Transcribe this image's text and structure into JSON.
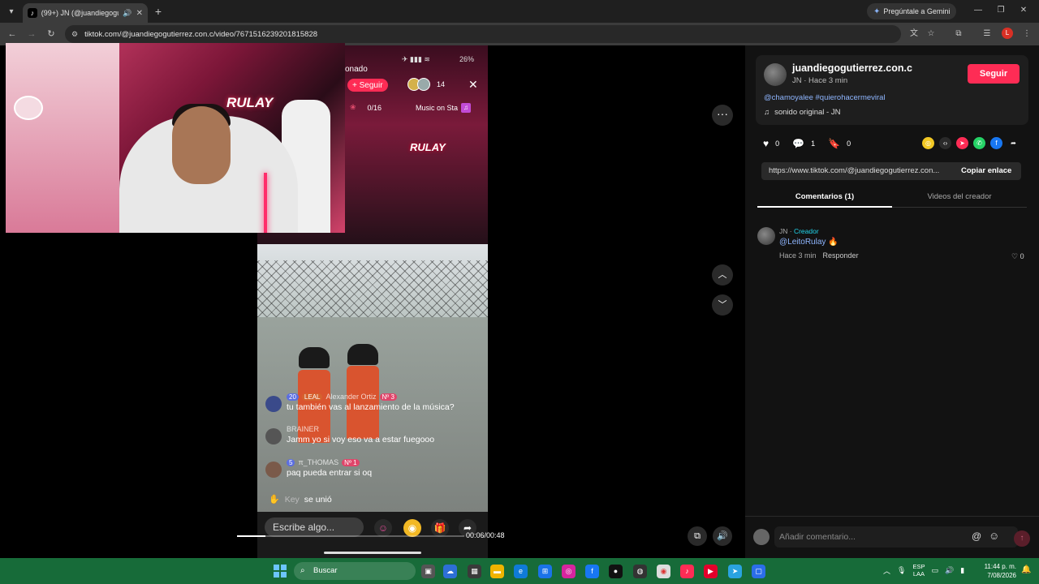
{
  "browser": {
    "tab_title": "(99+) JN (@juandiegogutie",
    "url": "tiktok.com/@juandiegogutierrez.con.c/video/7671516239201815828",
    "gemini_label": "Pregúntale a Gemini",
    "profile_initial": "L"
  },
  "live": {
    "title_fragment": "onado",
    "status_battery": "26%",
    "follow_label": "+ Seguir",
    "viewer_count": "14",
    "goal_count": "0/16",
    "music_label": "Music on Sta",
    "logo_text": "RULAY",
    "chat": [
      {
        "badge1": "20",
        "badge2": "LEAL",
        "name": "Alexander Ortiz",
        "badge3": "Nº 3",
        "message": "tu también vas al lanzamiento de la música?"
      },
      {
        "badge1": "",
        "badge2": "",
        "name": "BRAINER",
        "badge3": "",
        "message": "Jamm yo si voy eso va a estar fuegooo"
      },
      {
        "badge1": "5",
        "badge2": "",
        "name": "π_THOMAS",
        "badge3": "Nº 1",
        "message": "paq pueda entrar si oq"
      }
    ],
    "joined_name": "Key",
    "joined_text": "se unió",
    "comment_placeholder": "Escribe algo...",
    "progress_fraction": 0.125,
    "timecode": "00:06/00:48"
  },
  "creator": {
    "handle": "juandiegogutierrez.con.c",
    "subtitle": "JN · Hace 3 min",
    "follow_label": "Seguir",
    "hashtags": "@chamoyalee #quierohacermeviral",
    "sound": "sonido original - JN"
  },
  "stats": {
    "likes": "0",
    "comments": "1",
    "saves": "0"
  },
  "link": {
    "url": "https://www.tiktok.com/@juandiegogutierrez.con...",
    "copy_label": "Copiar enlace"
  },
  "tabs": {
    "comments": "Comentarios (1)",
    "creator_videos": "Videos del creador"
  },
  "comment": {
    "author": "JN",
    "author_tag": "Creador",
    "text": "@LeitoRulay",
    "time": "Hace 3 min",
    "reply_label": "Responder",
    "likes": "0"
  },
  "add_comment": {
    "placeholder": "Añadir comentario..."
  },
  "taskbar": {
    "search_label": "Buscar",
    "lang_top": "ESP",
    "lang_bottom": "LAA",
    "time": "11:44 p. m.",
    "date": "7/08/2026"
  },
  "colors": {
    "tiktok_red": "#fe2c55",
    "taskbar_green": "#176b39",
    "link_blue": "#8fb6ff",
    "creator_cyan": "#20d5ec"
  }
}
